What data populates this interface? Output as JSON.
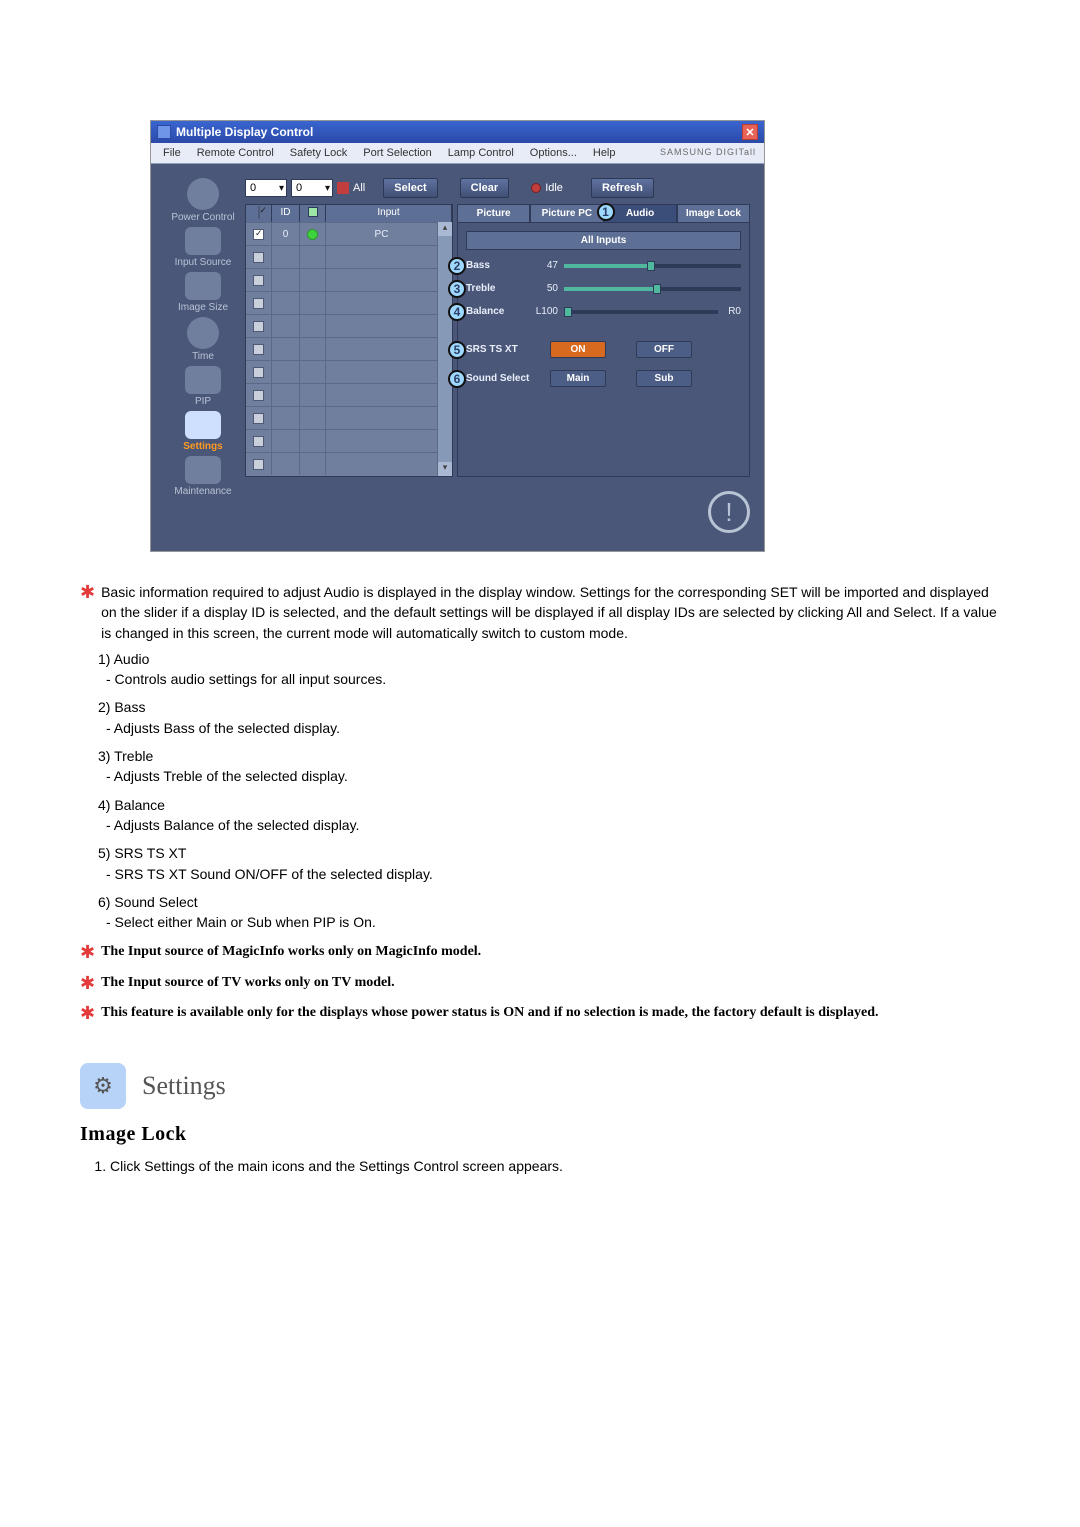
{
  "app": {
    "title": "Multiple Display Control",
    "menu": [
      "File",
      "Remote Control",
      "Safety Lock",
      "Port Selection",
      "Lamp Control",
      "Options...",
      "Help"
    ],
    "brand": "SAMSUNG DIGITall"
  },
  "sidebar": {
    "items": [
      {
        "label": "Power Control"
      },
      {
        "label": "Input Source"
      },
      {
        "label": "Image Size"
      },
      {
        "label": "Time"
      },
      {
        "label": "PIP"
      },
      {
        "label": "Settings"
      },
      {
        "label": "Maintenance"
      }
    ],
    "active_index": 5
  },
  "toolbar": {
    "dropdown1": "0",
    "dropdown2": "0",
    "all_checkbox_label": "All",
    "all_checked": true,
    "select_btn": "Select",
    "clear_btn": "Clear",
    "status_idle": "Idle",
    "refresh_btn": "Refresh"
  },
  "grid": {
    "headers": {
      "c1": "",
      "c2": "ID",
      "c3": "",
      "c4": "Input"
    },
    "row0": {
      "checked": true,
      "id": "0",
      "status": "on",
      "input": "PC"
    },
    "blank_rows": 10
  },
  "tabs": {
    "items": [
      "Picture",
      "Picture PC",
      "Audio",
      "Image Lock"
    ],
    "active_index": 2,
    "tab1_marker": "1"
  },
  "panel": {
    "all_inputs": "All Inputs",
    "rows": {
      "bass": {
        "marker": "2",
        "label": "Bass",
        "value": "47"
      },
      "treble": {
        "marker": "3",
        "label": "Treble",
        "value": "50"
      },
      "balance": {
        "marker": "4",
        "label": "Balance",
        "left": "L100",
        "right": "R0"
      },
      "srs": {
        "marker": "5",
        "label": "SRS TS XT",
        "on": "ON",
        "off": "OFF"
      },
      "sound": {
        "marker": "6",
        "label": "Sound Select",
        "main": "Main",
        "sub": "Sub"
      }
    }
  },
  "doc": {
    "intro": "Basic information required to adjust Audio is displayed in the display window. Settings for the corresponding SET will be imported and displayed on the slider if a display ID is selected, and the default settings will be displayed if all display IDs are selected by clicking All and Select. If a value is changed in this screen, the current mode will automatically switch to custom mode.",
    "items": [
      {
        "num": "1)",
        "title": "Audio",
        "desc": "- Controls audio settings for all input sources."
      },
      {
        "num": "2)",
        "title": "Bass",
        "desc": "- Adjusts Bass of the selected display."
      },
      {
        "num": "3)",
        "title": "Treble",
        "desc": "- Adjusts Treble of the selected display."
      },
      {
        "num": "4)",
        "title": "Balance",
        "desc": "- Adjusts Balance of the selected display."
      },
      {
        "num": "5)",
        "title": "SRS TS XT",
        "desc": "- SRS TS XT Sound ON/OFF of the selected display."
      },
      {
        "num": "6)",
        "title": "Sound Select",
        "desc": "- Select either Main or Sub when PIP is On."
      }
    ],
    "notes": [
      "The Input source of MagicInfo works only on MagicInfo model.",
      "The Input source of TV works only on TV model.",
      "This feature is available only for the displays whose power status is ON and if no selection is made, the factory default is displayed."
    ],
    "section_heading": "Settings",
    "subheading": "Image Lock",
    "step1": "Click Settings of the main icons and the Settings Control screen appears."
  }
}
